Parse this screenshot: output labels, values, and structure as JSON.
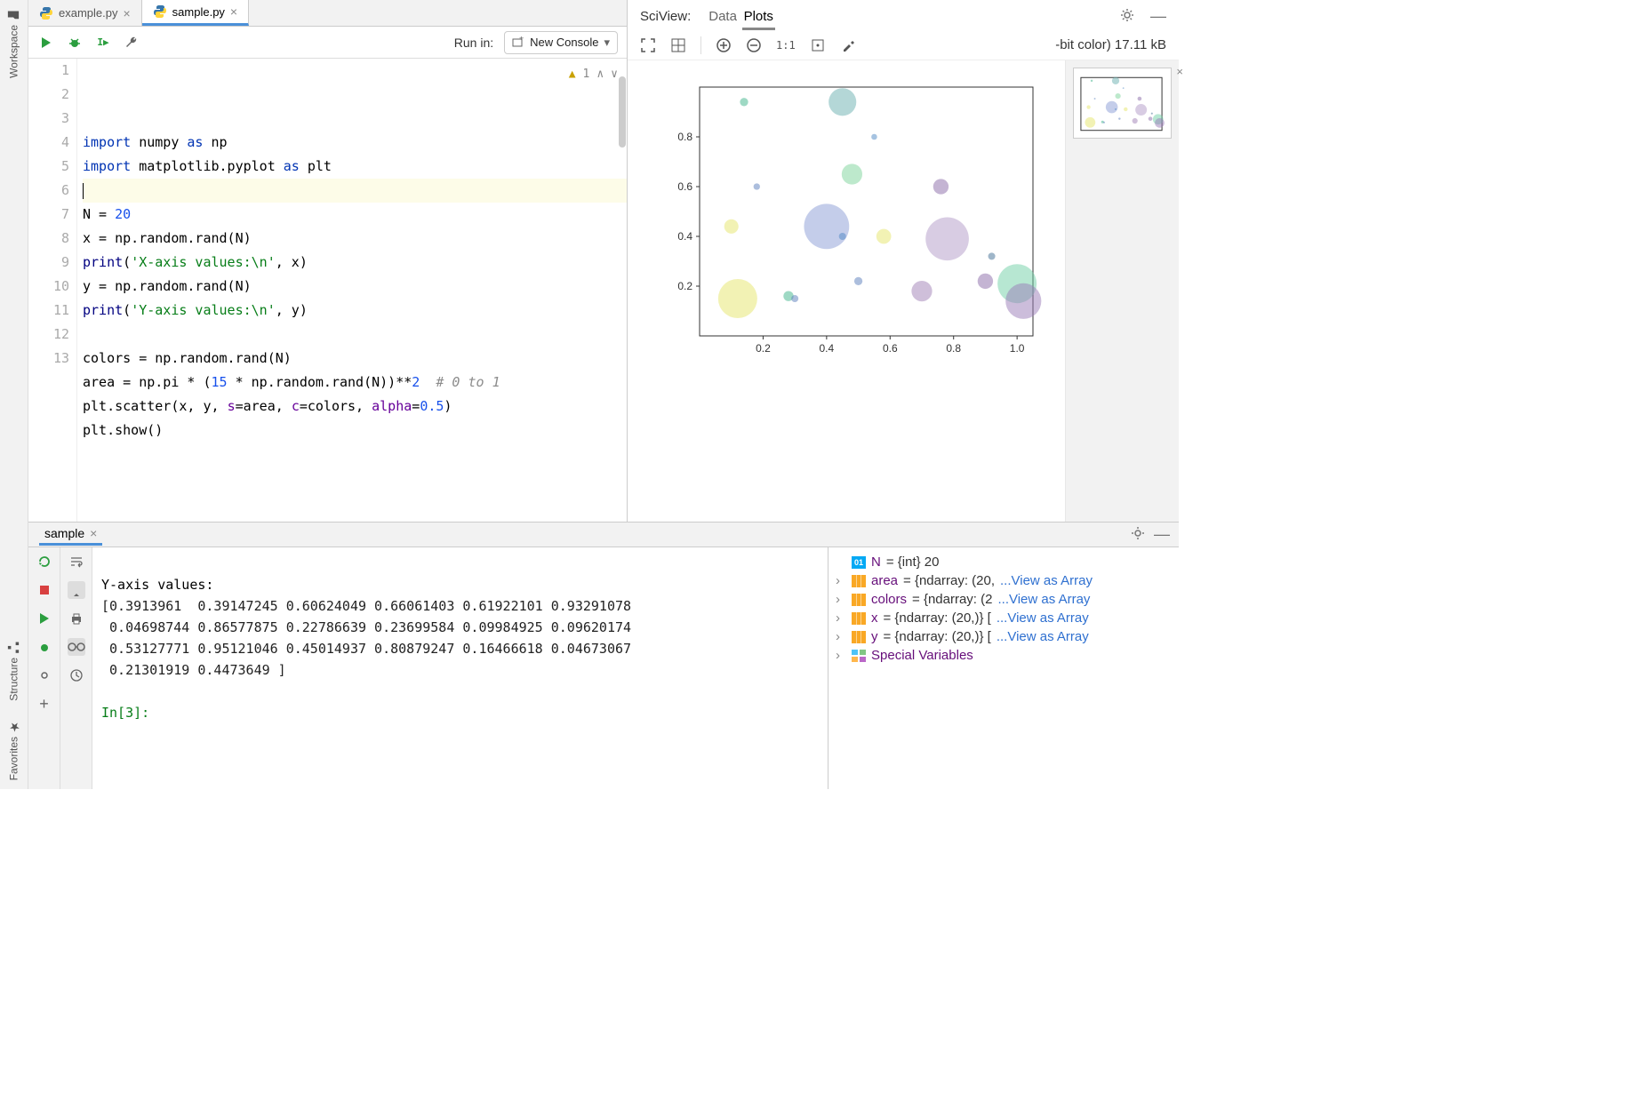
{
  "left_gutter": {
    "workspace_label": "Workspace",
    "structure_label": "Structure",
    "favorites_label": "Favorites"
  },
  "editor": {
    "tabs": [
      {
        "label": "example.py",
        "active": false
      },
      {
        "label": "sample.py",
        "active": true
      }
    ],
    "run_in_label": "Run in:",
    "run_select": "New Console",
    "inspection_count": "1",
    "code_lines": [
      {
        "n": 1,
        "tokens": [
          [
            "kw",
            "import"
          ],
          [
            "name",
            " numpy "
          ],
          [
            "kw",
            "as"
          ],
          [
            "name",
            " np"
          ]
        ]
      },
      {
        "n": 2,
        "tokens": [
          [
            "kw",
            "import"
          ],
          [
            "name",
            " matplotlib.pyplot "
          ],
          [
            "kw",
            "as"
          ],
          [
            "name",
            " plt"
          ]
        ]
      },
      {
        "n": 3,
        "hl": true,
        "caret": true,
        "tokens": []
      },
      {
        "n": 4,
        "tokens": [
          [
            "name",
            "N = "
          ],
          [
            "num",
            "20"
          ]
        ]
      },
      {
        "n": 5,
        "tokens": [
          [
            "name",
            "x = np.random.rand(N)"
          ]
        ]
      },
      {
        "n": 6,
        "tokens": [
          [
            "kw2",
            "print"
          ],
          [
            "name",
            "("
          ],
          [
            "str",
            "'X-axis values:\\n'"
          ],
          [
            "name",
            ", x)"
          ]
        ]
      },
      {
        "n": 7,
        "tokens": [
          [
            "name",
            "y = np.random.rand(N)"
          ]
        ]
      },
      {
        "n": 8,
        "tokens": [
          [
            "kw2",
            "print"
          ],
          [
            "name",
            "("
          ],
          [
            "str",
            "'Y-axis values:\\n'"
          ],
          [
            "name",
            ", y)"
          ]
        ]
      },
      {
        "n": 9,
        "tokens": []
      },
      {
        "n": 10,
        "tokens": [
          [
            "name",
            "colors = np.random.rand(N)"
          ]
        ]
      },
      {
        "n": 11,
        "tokens": [
          [
            "name",
            "area = np.pi * ("
          ],
          [
            "num",
            "15"
          ],
          [
            "name",
            " * np.random.rand(N))**"
          ],
          [
            "num",
            "2"
          ],
          [
            "name",
            "  "
          ],
          [
            "cm",
            "# 0 to 1"
          ]
        ]
      },
      {
        "n": 12,
        "tokens": [
          [
            "name",
            "plt.scatter(x, y, "
          ],
          [
            "kwarg",
            "s"
          ],
          [
            "name",
            "=area, "
          ],
          [
            "kwarg",
            "c"
          ],
          [
            "name",
            "=colors, "
          ],
          [
            "kwarg",
            "alpha"
          ],
          [
            "name",
            "="
          ],
          [
            "num",
            "0.5"
          ],
          [
            "name",
            ")"
          ]
        ]
      },
      {
        "n": 13,
        "tokens": [
          [
            "name",
            "plt.show()"
          ]
        ]
      }
    ]
  },
  "sciview": {
    "title": "SciView:",
    "tabs": [
      {
        "label": "Data",
        "active": false
      },
      {
        "label": "Plots",
        "active": true
      }
    ],
    "image_info": "-bit color) 17.11 kB",
    "zoom_11": "1:1"
  },
  "chart_data": {
    "type": "scatter",
    "title": "",
    "xlabel": "",
    "ylabel": "",
    "xlim": [
      0.0,
      1.05
    ],
    "ylim": [
      0.0,
      1.0
    ],
    "xticks": [
      0.2,
      0.4,
      0.6,
      0.8,
      1.0
    ],
    "yticks": [
      0.2,
      0.4,
      0.6,
      0.8
    ],
    "alpha": 0.5,
    "points": [
      {
        "x": 0.12,
        "y": 0.15,
        "size": 900,
        "color": "#e6e66a"
      },
      {
        "x": 0.1,
        "y": 0.44,
        "size": 120,
        "color": "#e6e66a"
      },
      {
        "x": 0.14,
        "y": 0.94,
        "size": 40,
        "color": "#3eb489"
      },
      {
        "x": 0.18,
        "y": 0.6,
        "size": 25,
        "color": "#5a7dbb"
      },
      {
        "x": 0.28,
        "y": 0.16,
        "size": 60,
        "color": "#3eb489"
      },
      {
        "x": 0.3,
        "y": 0.15,
        "size": 30,
        "color": "#5a7dbb"
      },
      {
        "x": 0.4,
        "y": 0.44,
        "size": 1200,
        "color": "#8a9cd6"
      },
      {
        "x": 0.45,
        "y": 0.94,
        "size": 450,
        "color": "#6ab0b0"
      },
      {
        "x": 0.48,
        "y": 0.65,
        "size": 250,
        "color": "#7cd39a"
      },
      {
        "x": 0.5,
        "y": 0.22,
        "size": 40,
        "color": "#5a7dbb"
      },
      {
        "x": 0.58,
        "y": 0.4,
        "size": 130,
        "color": "#e6e66a"
      },
      {
        "x": 0.7,
        "y": 0.18,
        "size": 250,
        "color": "#a080b5"
      },
      {
        "x": 0.78,
        "y": 0.39,
        "size": 1100,
        "color": "#b29ac8"
      },
      {
        "x": 0.76,
        "y": 0.6,
        "size": 140,
        "color": "#8a6aa8"
      },
      {
        "x": 0.9,
        "y": 0.22,
        "size": 140,
        "color": "#8a6aa8"
      },
      {
        "x": 0.92,
        "y": 0.32,
        "size": 30,
        "color": "#3f6e94"
      },
      {
        "x": 1.0,
        "y": 0.21,
        "size": 900,
        "color": "#6fcfa5"
      },
      {
        "x": 1.02,
        "y": 0.14,
        "size": 750,
        "color": "#9a7bb8"
      },
      {
        "x": 0.55,
        "y": 0.8,
        "size": 20,
        "color": "#4d88c4"
      },
      {
        "x": 0.45,
        "y": 0.4,
        "size": 30,
        "color": "#4d88c4"
      }
    ]
  },
  "console": {
    "tab_label": "sample",
    "output_label": "Y-axis values:",
    "output_values_line1": "[0.3913961  0.39147245 0.60624049 0.66061403 0.61922101 0.93291078",
    "output_values_line2": " 0.04698744 0.86577875 0.22786639 0.23699584 0.09984925 0.09620174",
    "output_values_line3": " 0.53127771 0.95121046 0.45014937 0.80879247 0.16466618 0.04673067",
    "output_values_line4": " 0.21301919 0.4473649 ]",
    "prompt": "In[3]:"
  },
  "variables": [
    {
      "kind": "int",
      "name": "N",
      "value": "{int} 20",
      "link": ""
    },
    {
      "kind": "ndarray",
      "expandable": true,
      "name": "area",
      "value": "{ndarray: (20,",
      "link": "...View as Array"
    },
    {
      "kind": "ndarray",
      "expandable": true,
      "name": "colors",
      "value": "{ndarray: (2",
      "link": "...View as Array"
    },
    {
      "kind": "ndarray",
      "expandable": true,
      "name": "x",
      "value": "{ndarray: (20,)} [",
      "link": "...View as Array"
    },
    {
      "kind": "ndarray",
      "expandable": true,
      "name": "y",
      "value": "{ndarray: (20,)} [",
      "link": "...View as Array"
    },
    {
      "kind": "special",
      "expandable": true,
      "name": "Special Variables",
      "value": "",
      "link": ""
    }
  ]
}
